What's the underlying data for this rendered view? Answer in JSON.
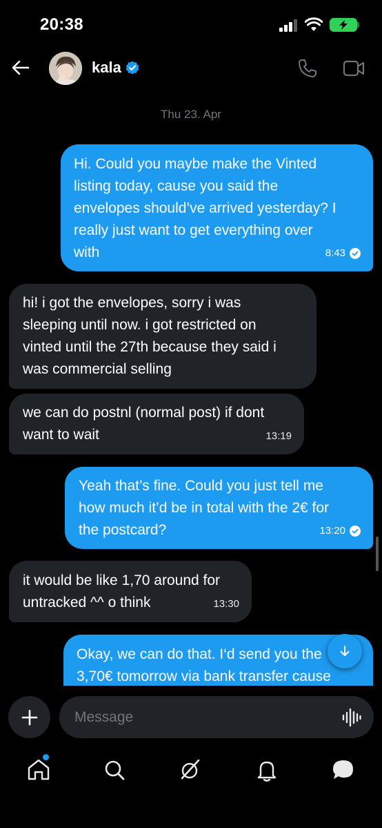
{
  "status": {
    "time": "20:38"
  },
  "header": {
    "name": "kala"
  },
  "date_separator": "Thu 23. Apr",
  "messages": [
    {
      "text": "Hi. Could you maybe make the Vinted\nlisting today, cause you said the\nenvelopes should’ve arrived yesterday? I\nreally just want to get everything over\nwith",
      "time": "8:43"
    },
    {
      "text": "hi! i got the envelopes, sorry i was\nsleeping until now. i got restricted on\nvinted until the 27th because they said i\nwas commercial selling"
    },
    {
      "text": "we can do postnl (normal post) if dont\nwant to wait",
      "time": "13:19"
    },
    {
      "text": "Yeah that’s fine. Could you just tell me\nhow much it’d be in total with the 2€ for\nthe postcard?",
      "time": "13:20"
    },
    {
      "text": "it would be like 1,70 around for\nuntracked ^^ o think",
      "time": "13:30"
    },
    {
      "text": "Okay, we can do that. I‘d send you the\n3,70€ tomorrow via bank transfer cause"
    }
  ],
  "composer": {
    "placeholder": "Message"
  },
  "colors": {
    "accent": "#1d9bf0",
    "incoming": "#202327",
    "background": "#000000",
    "battery": "#30d158"
  }
}
